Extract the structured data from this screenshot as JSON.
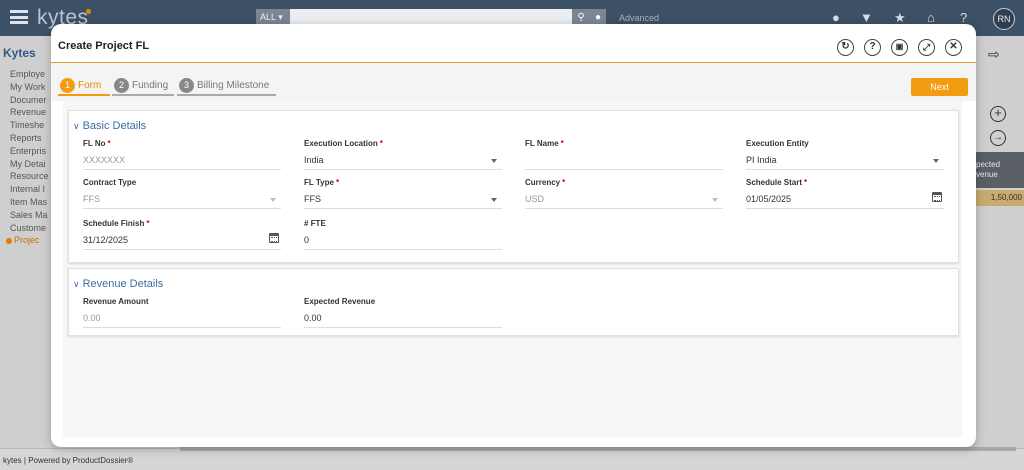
{
  "app": {
    "logo": "kytes",
    "search": {
      "scope": "ALL",
      "placeholder": "",
      "advanced_label": "Advanced"
    },
    "user_initials": "RN",
    "sidebar_title": "Kytes",
    "sidebar_items": [
      "Employe",
      "My Work",
      "Documer",
      "Revenue",
      "Timeshe",
      "Reports",
      "Enterpris",
      "My Detai",
      "Resource",
      "Internal I",
      "Item Mas",
      "Sales Ma",
      "Custome"
    ],
    "sidebar_active": "Projec",
    "right_panel": {
      "column_header": "pected venue",
      "value": "1,50,000"
    },
    "footer": "kytes | Powered by ProductDossier®"
  },
  "modal": {
    "title": "Create Project FL",
    "steps": [
      {
        "number": "1",
        "label": "Form",
        "active": true
      },
      {
        "number": "2",
        "label": "Funding",
        "active": false
      },
      {
        "number": "3",
        "label": "Billing Milestone",
        "active": false
      }
    ],
    "next_label": "Next",
    "basic_details": {
      "title": "Basic Details",
      "fields": {
        "fl_no": {
          "label": "FL No",
          "value": "XXXXXXX"
        },
        "execution_location": {
          "label": "Execution Location",
          "value": "India"
        },
        "fl_name": {
          "label": "FL Name",
          "value": ""
        },
        "execution_entity": {
          "label": "Execution Entity",
          "value": "PI India"
        },
        "contract_type": {
          "label": "Contract Type",
          "value": "FFS"
        },
        "fl_type": {
          "label": "FL Type",
          "value": "FFS"
        },
        "currency": {
          "label": "Currency",
          "value": "USD"
        },
        "schedule_start": {
          "label": "Schedule Start",
          "value": "01/05/2025"
        },
        "schedule_finish": {
          "label": "Schedule Finish",
          "value": "31/12/2025"
        },
        "fte": {
          "label": "# FTE",
          "value": "0"
        }
      }
    },
    "revenue_details": {
      "title": "Revenue Details",
      "fields": {
        "revenue_amount": {
          "label": "Revenue Amount",
          "value": "0.00"
        },
        "expected_revenue": {
          "label": "Expected Revenue",
          "value": "0.00"
        }
      }
    }
  },
  "colors": {
    "accent": "#f39c12",
    "header_bg": "#3d5166",
    "section_title": "#3a6ea5",
    "required": "#d0021b"
  },
  "icons": [
    "hamburger-icon",
    "search-icon",
    "mic-icon",
    "bell-icon",
    "download-icon",
    "star-icon",
    "home-icon",
    "help-icon",
    "refresh-icon",
    "save-icon",
    "expand-icon",
    "close-icon",
    "calendar-icon",
    "plus-icon",
    "arrow-right-icon",
    "export-icon"
  ]
}
